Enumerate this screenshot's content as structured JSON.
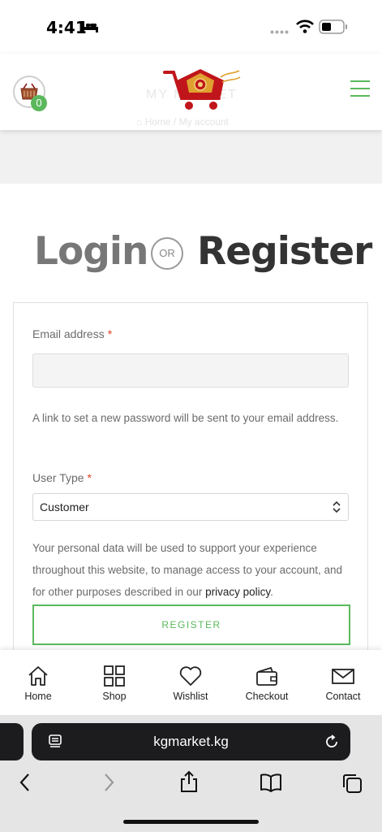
{
  "status_bar": {
    "time": "4:41"
  },
  "header": {
    "cart_count": "0",
    "logo_text": "MY MARKET",
    "breadcrumb": "⌂ Home / My account",
    "brand_color": "#5bb85c"
  },
  "heading": {
    "login": "Login",
    "or": "OR",
    "register": "Register"
  },
  "form": {
    "email_label": "Email address",
    "required_mark": "*",
    "email_value": "",
    "hint": "A link to set a new password will be sent to your email address.",
    "user_type_label": "User Type",
    "user_type_selected": "Customer",
    "privacy_text": "Your personal data will be used to support your experience throughout this website, to manage access to your account, and for other purposes described in our ",
    "privacy_link": "privacy policy",
    "privacy_end": ".",
    "register_button": "REGISTER"
  },
  "bottom_nav": {
    "items": [
      {
        "label": "Home",
        "icon": "home-icon"
      },
      {
        "label": "Shop",
        "icon": "grid-icon"
      },
      {
        "label": "Wishlist",
        "icon": "heart-icon"
      },
      {
        "label": "Checkout",
        "icon": "wallet-icon"
      },
      {
        "label": "Contact",
        "icon": "mail-icon"
      }
    ]
  },
  "browser": {
    "url": "kgmarket.kg"
  }
}
